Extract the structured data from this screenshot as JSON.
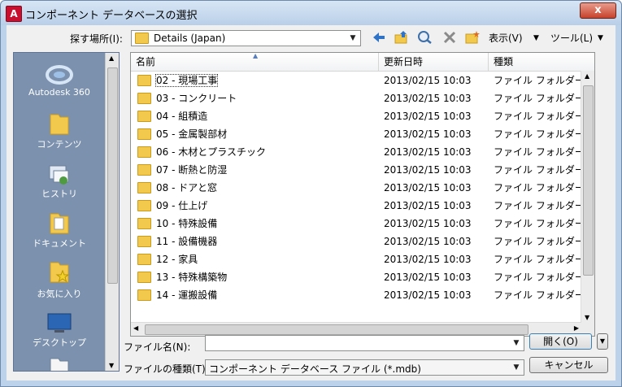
{
  "window": {
    "title": "コンポーネント データベースの選択",
    "close_label": "x"
  },
  "lookin": {
    "label": "探す場所(I):",
    "value": "Details (Japan)"
  },
  "toolbar": {
    "view_label": "表示(V)",
    "tools_label": "ツール(L)"
  },
  "places": [
    {
      "label": "Autodesk 360",
      "icon": "cloud-icon"
    },
    {
      "label": "コンテンツ",
      "icon": "folder-icon"
    },
    {
      "label": "ヒストリ",
      "icon": "history-icon"
    },
    {
      "label": "ドキュメント",
      "icon": "documents-icon"
    },
    {
      "label": "お気に入り",
      "icon": "favorites-icon"
    },
    {
      "label": "デスクトップ",
      "icon": "desktop-icon"
    }
  ],
  "list": {
    "columns": [
      "名前",
      "更新日時",
      "種類"
    ],
    "rows": [
      {
        "name": "02 - 現場工事",
        "date": "2013/02/15 10:03",
        "type": "ファイル フォルダー"
      },
      {
        "name": "03 - コンクリート",
        "date": "2013/02/15 10:03",
        "type": "ファイル フォルダー"
      },
      {
        "name": "04 - 組積造",
        "date": "2013/02/15 10:03",
        "type": "ファイル フォルダー"
      },
      {
        "name": "05 - 金属製部材",
        "date": "2013/02/15 10:03",
        "type": "ファイル フォルダー"
      },
      {
        "name": "06 - 木材とプラスチック",
        "date": "2013/02/15 10:03",
        "type": "ファイル フォルダー"
      },
      {
        "name": "07 - 断熱と防湿",
        "date": "2013/02/15 10:03",
        "type": "ファイル フォルダー"
      },
      {
        "name": "08 - ドアと窓",
        "date": "2013/02/15 10:03",
        "type": "ファイル フォルダー"
      },
      {
        "name": "09 - 仕上げ",
        "date": "2013/02/15 10:03",
        "type": "ファイル フォルダー"
      },
      {
        "name": "10 - 特殊設備",
        "date": "2013/02/15 10:03",
        "type": "ファイル フォルダー"
      },
      {
        "name": "11 - 設備機器",
        "date": "2013/02/15 10:03",
        "type": "ファイル フォルダー"
      },
      {
        "name": "12 - 家具",
        "date": "2013/02/15 10:03",
        "type": "ファイル フォルダー"
      },
      {
        "name": "13 - 特殊構築物",
        "date": "2013/02/15 10:03",
        "type": "ファイル フォルダー"
      },
      {
        "name": "14 - 運搬設備",
        "date": "2013/02/15 10:03",
        "type": "ファイル フォルダー"
      }
    ]
  },
  "filename": {
    "label": "ファイル名(N):",
    "value": ""
  },
  "filetype": {
    "label": "ファイルの種類(T):",
    "value": "コンポーネント データベース ファイル (*.mdb)"
  },
  "buttons": {
    "open": "開く(O)",
    "cancel": "キャンセル"
  }
}
